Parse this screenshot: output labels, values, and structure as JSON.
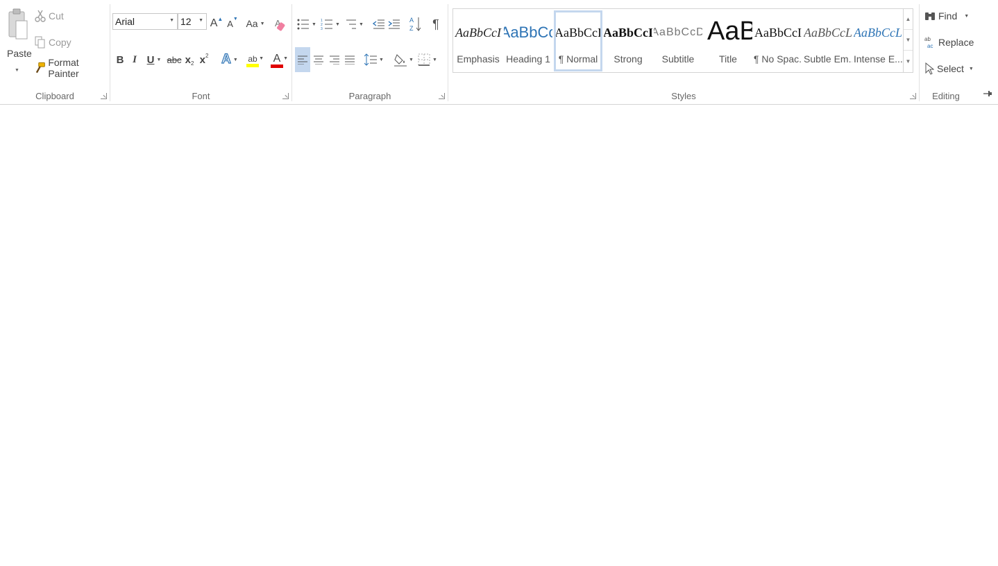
{
  "clipboard": {
    "label": "Clipboard",
    "paste": "Paste",
    "cut": "Cut",
    "copy": "Copy",
    "format_painter": "Format Painter"
  },
  "font": {
    "label": "Font",
    "font_name": "Arial",
    "font_size": "12",
    "change_case": "Aa",
    "bold": "B",
    "italic": "I",
    "underline": "U",
    "strikethrough": "abc",
    "subscript": "x",
    "superscript": "x",
    "grow": "A",
    "shrink": "A",
    "text_effects": "A",
    "highlight": "ab",
    "font_color": "A",
    "highlight_color": "#ffff00",
    "font_color_value": "#e00000"
  },
  "paragraph": {
    "label": "Paragraph",
    "show_marks": "¶"
  },
  "styles": {
    "label": "Styles",
    "items": [
      {
        "preview": "AaBbCcI",
        "name": "Emphasis"
      },
      {
        "preview": "AaBbCc",
        "name": "Heading 1"
      },
      {
        "preview": "AaBbCcI",
        "name": "¶ Normal"
      },
      {
        "preview": "AaBbCcI",
        "name": "Strong"
      },
      {
        "preview": "AaBbCcD",
        "name": "Subtitle"
      },
      {
        "preview": "AaBl",
        "name": "Title"
      },
      {
        "preview": "AaBbCcI",
        "name": "¶ No Spac..."
      },
      {
        "preview": "AaBbCcL",
        "name": "Subtle Em..."
      },
      {
        "preview": "AaBbCcL",
        "name": "Intense E..."
      }
    ],
    "accent_color": "#2e74b5"
  },
  "editing": {
    "label": "Editing",
    "find": "Find",
    "replace": "Replace",
    "select": "Select"
  }
}
